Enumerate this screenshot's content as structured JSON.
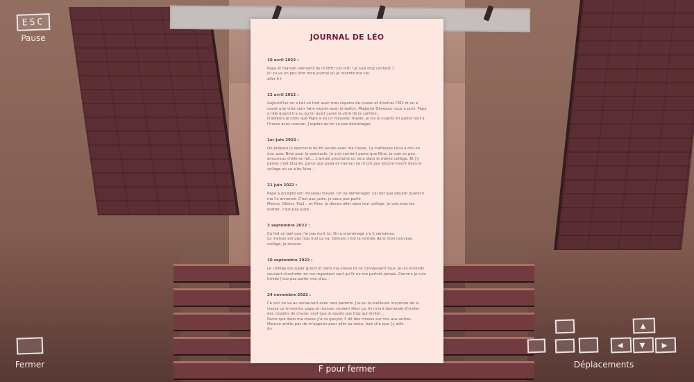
{
  "hud": {
    "esc_key": "ESC",
    "pause_label": "Pause",
    "fermer_label": "Fermer",
    "deplacements_label": "Déplacements",
    "close_hint": "F pour fermer"
  },
  "journal": {
    "title": "JOURNAL DE LÉO",
    "entries": [
      {
        "date": "10 avril 2022 :",
        "text": "Papa et maman viennent de m'offrir cet ordi ! Je suis trop content :)\nIci ça va un peu être mon journal où je raconte ma vie,\naller A+"
      },
      {
        "date": "12 avril 2022 :",
        "text": "Aujourd'hui on a fait un foot avec mes copains de classe et d'autres CM2 et on a cassé une vitre sans faire exprès avec le ballon. Madame Deveaux nous a puni. Papa a râlé quand il a su qu'on avait cassé la vitre de la cantine...\nD'ailleurs je crois que Papa a eu un nouveau travail. Je les ai surpris en parler tout à l'heure avec maman. J'espère qu'on va pas déménager"
      },
      {
        "date": "1er juin 2022 :",
        "text": "On prépare le spectacle de fin année avec ma classe. La maîtresse nous a mis en duo avec Nina pour le spectacle. Je suis content parce que Nina, je suis un peu amoureux d'elle en fait... L'année prochaine on sera dans le même collège. Et j'y pense c'est bizarre, parce que papa et maman ne m'ont pas encore inscrit dans le collège où va aller Nina..."
      },
      {
        "date": "21 juin 2022 :",
        "text": "Papa a accepté son nouveau travail. On va déménager. J'ai fait que pleurer quand il me l'a annoncé. C'est pas juste, je veux pas partir.\nMarius, Olivier, Paul... et Nina. Je devais aller dans leur collège.  Je vais tous les quitter, c'est pas juste."
      },
      {
        "date": "3 septembre 2022 :",
        "text": "Ça fait un bail que j'ai pas écrit ici. On a emménagé y'a 2 semaines.\nLa maison est pas trop mal ça va. Demain c'est la rentrée dans mon nouveau collège, je stresse"
      },
      {
        "date": "10 septembre 2022 :",
        "text": "Le collège est super grand et dans ma classe ils se connaissent tous. Je les entends souvent chuchoter en me regardant sauf qu'ils ne me parlent jamais. Comme je suis timide j'ose pas parler non plus..."
      },
      {
        "date": "24 novembre 2022 :",
        "text": "Ce soir on va au restaurant avec mes parents. J'ai eu la meilleure moyenne de la classe ce trimestre, papa et maman veulent fêter ça. Ils m'ont demandé d'inviter des copains de classe, sauf que je savais pas trop qui inviter...\nParce que dans ma classe y'a ce garçon, il dit des choses sur moi aux autres.\nMaman arrête pas de m'appeler pour aller au resto, faut vite que j'y aille\nA+"
      }
    ]
  }
}
